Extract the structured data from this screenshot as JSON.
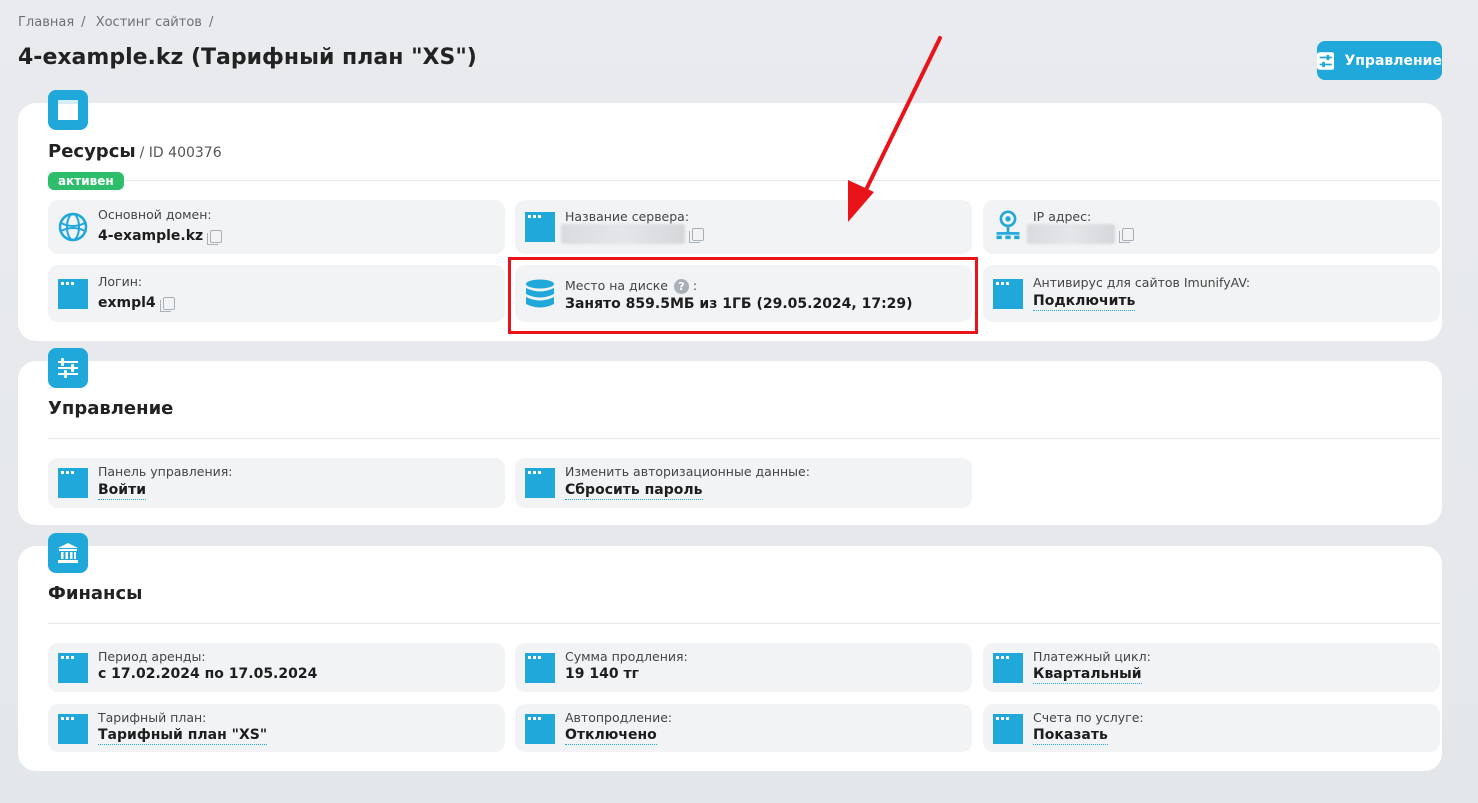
{
  "breadcrumb": [
    "Главная",
    "Хостинг сайтов"
  ],
  "page_title": "4-example.kz (Тарифный план \"XS\")",
  "header_button": "Управление",
  "resources": {
    "title": "Ресурсы",
    "id": "/ ID 400376",
    "status": "активен",
    "domain": {
      "label": "Основной домен:",
      "value": "4-example.kz"
    },
    "server": {
      "label": "Название сервера:"
    },
    "ip": {
      "label": "IP адрес:"
    },
    "login": {
      "label": "Логин:",
      "value": "exmpl4"
    },
    "disk": {
      "label": "Место на диске",
      "help": "?",
      "colon": ":",
      "value": "Занято 859.5МБ из 1ГБ (29.05.2024, 17:29)"
    },
    "antivirus": {
      "label": "Антивирус для сайтов ImunifyAV:",
      "value": "Подключить"
    }
  },
  "management": {
    "title": "Управление",
    "panel": {
      "label": "Панель управления:",
      "value": "Войти"
    },
    "auth": {
      "label": "Изменить авторизационные данные:",
      "value": "Сбросить пароль"
    }
  },
  "finance": {
    "title": "Финансы",
    "period": {
      "label": "Период аренды:",
      "value": "с 17.02.2024 по 17.05.2024"
    },
    "renewal": {
      "label": "Сумма продления:",
      "value": "19 140 тг"
    },
    "cycle": {
      "label": "Платежный цикл:",
      "value": "Квартальный"
    },
    "plan": {
      "label": "Тарифный план:",
      "value": "Тарифный план \"XS\""
    },
    "autorenew": {
      "label": "Автопродление:",
      "value": "Отключено"
    },
    "invoices": {
      "label": "Счета по услуге:",
      "value": "Показать"
    }
  },
  "colors": {
    "accent": "#1fa8d9",
    "status_green": "#2ebd6a",
    "annotation_red": "#e8141a"
  }
}
